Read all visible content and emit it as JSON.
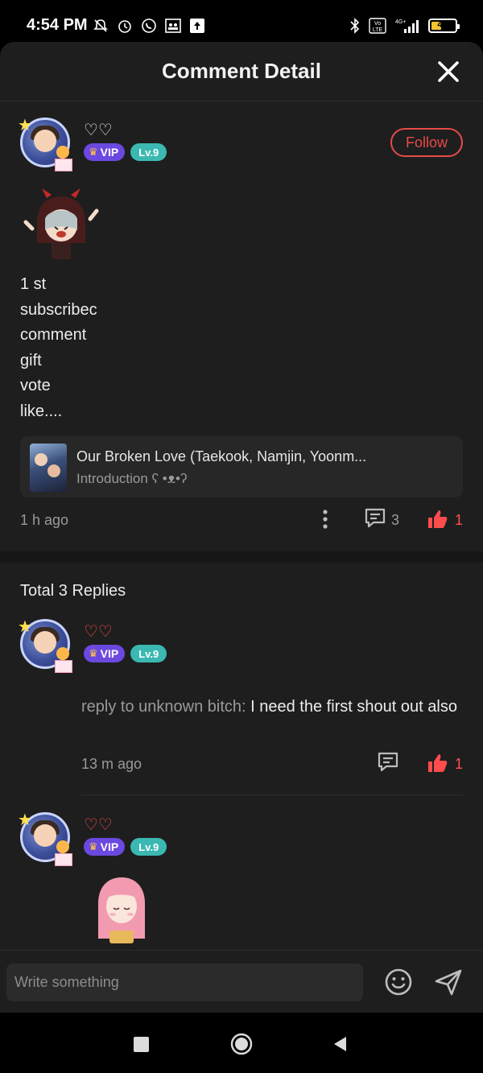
{
  "status_bar": {
    "time": "4:54 PM",
    "battery": "42",
    "battery_level": 0.42,
    "network": "4G+",
    "icons_left": [
      "mute-bell-icon",
      "alarm-icon",
      "whatsapp-icon",
      "group-icon",
      "upload-icon"
    ],
    "icons_right": [
      "bluetooth-icon",
      "volte-icon",
      "signal-icon",
      "battery-icon"
    ]
  },
  "header": {
    "title": "Comment Detail",
    "close_icon": "close-icon"
  },
  "main_comment": {
    "username": "♡♡",
    "vip_label": "VIP",
    "level_label": "Lv.9",
    "follow_label": "Follow",
    "lines": [
      "1 st",
      "subscribec",
      "comment",
      "gift",
      "vote",
      "like...."
    ],
    "book": {
      "title": "Our Broken Love (Taekook, Namjin, Yoonm...",
      "intro": "Introduction ʕ •ᴥ•ʔ"
    },
    "time": "1 h ago",
    "reply_count": "3",
    "like_count": "1"
  },
  "replies_section": {
    "total_label": "Total 3 Replies"
  },
  "replies": [
    {
      "username": "♡♡",
      "vip_label": "VIP",
      "level_label": "Lv.9",
      "prefix": "reply to unknown bitch:",
      "text": " I need the first shout out also",
      "time": "13 m ago",
      "like_count": "1"
    },
    {
      "username": "♡♡",
      "vip_label": "VIP",
      "level_label": "Lv.9"
    }
  ],
  "input": {
    "placeholder": "Write something"
  },
  "colors": {
    "background": "#1e1e1e",
    "accent_red": "#e84a4a",
    "vip_purple": "#6b48e0",
    "level_teal": "#3bb8b1"
  }
}
